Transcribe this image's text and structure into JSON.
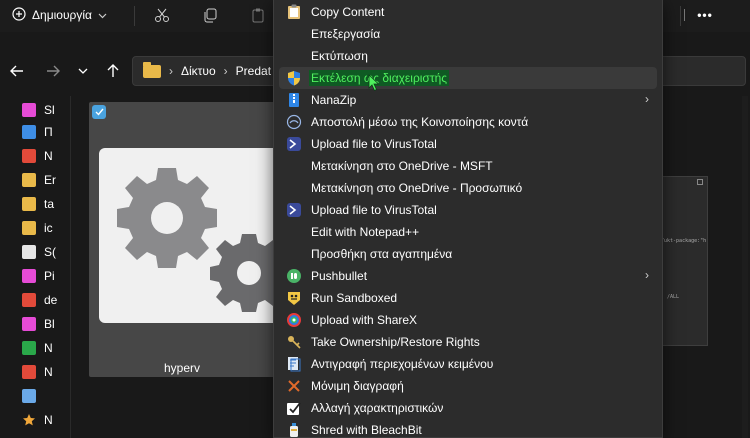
{
  "toolbar": {
    "new_label": "Δημιουργία",
    "new_icon": "plus-circle-icon",
    "more_label": "•••"
  },
  "navigation": {
    "path": [
      "Δίκτυο",
      "Predat"
    ]
  },
  "sidebar": {
    "items": [
      {
        "label": "Sl",
        "color": "#e64bd6"
      },
      {
        "label": "Π",
        "color": "#3e8ee6"
      },
      {
        "label": "N",
        "color": "#e24a3a"
      },
      {
        "label": "Er",
        "color": "#e9b949"
      },
      {
        "label": "ta",
        "color": "#e9b949"
      },
      {
        "label": "ic",
        "color": "#e9b949"
      },
      {
        "label": "S(",
        "color": "#e6e6e6"
      },
      {
        "label": "Pi",
        "color": "#e64bd6"
      },
      {
        "label": "de",
        "color": "#e24a3a"
      },
      {
        "label": "Bl",
        "color": "#e64bd6"
      },
      {
        "label": "N",
        "color": "#2aa84a"
      },
      {
        "label": "N",
        "color": "#e24a3a"
      },
      {
        "label": "",
        "color": "#6aa9e8"
      },
      {
        "label": "N",
        "color": "#f0a73a"
      }
    ]
  },
  "content": {
    "file_name": "hyperv",
    "preview_lines": [
      "/ukt-package:\"h",
      ", /ALL"
    ]
  },
  "context_menu": {
    "items": [
      {
        "label": "Copy Content",
        "icon": "clipboard-icon"
      },
      {
        "label": "Επεξεργασία",
        "icon": ""
      },
      {
        "label": "Εκτύπωση",
        "icon": ""
      },
      {
        "label": "Εκτέλεση ως διαχειριστής",
        "icon": "uac-shield-icon",
        "highlighted": true
      },
      {
        "label": "NanaZip",
        "icon": "nanazip-icon",
        "submenu": true
      },
      {
        "label": "Αποστολή μέσω της Κοινοποίησης κοντά",
        "icon": "nearby-share-icon"
      },
      {
        "label": "Upload file to VirusTotal",
        "icon": "virustotal-icon"
      },
      {
        "label": "Μετακίνηση στο OneDrive - MSFT",
        "icon": ""
      },
      {
        "label": "Μετακίνηση στο OneDrive - Προσωπικό",
        "icon": ""
      },
      {
        "label": "Upload file to VirusTotal",
        "icon": "virustotal-icon"
      },
      {
        "label": "Edit with Notepad++",
        "icon": ""
      },
      {
        "label": "Προσθήκη στα αγαπημένα",
        "icon": ""
      },
      {
        "label": "Pushbullet",
        "icon": "pushbullet-icon",
        "submenu": true
      },
      {
        "label": "Run Sandboxed",
        "icon": "sandboxie-icon"
      },
      {
        "label": "Upload with ShareX",
        "icon": "sharex-icon"
      },
      {
        "label": "Take Ownership/Restore Rights",
        "icon": "keys-icon"
      },
      {
        "label": "Αντιγραφή περιεχομένων κειμένου",
        "icon": "copy-text-icon"
      },
      {
        "label": "Μόνιμη διαγραφή",
        "icon": "delete-x-icon"
      },
      {
        "label": "Αλλαγή χαρακτηριστικών",
        "icon": "attributes-icon"
      },
      {
        "label": "Shred with BleachBit",
        "icon": "bleachbit-icon"
      }
    ],
    "submenu_glyph": "›"
  }
}
